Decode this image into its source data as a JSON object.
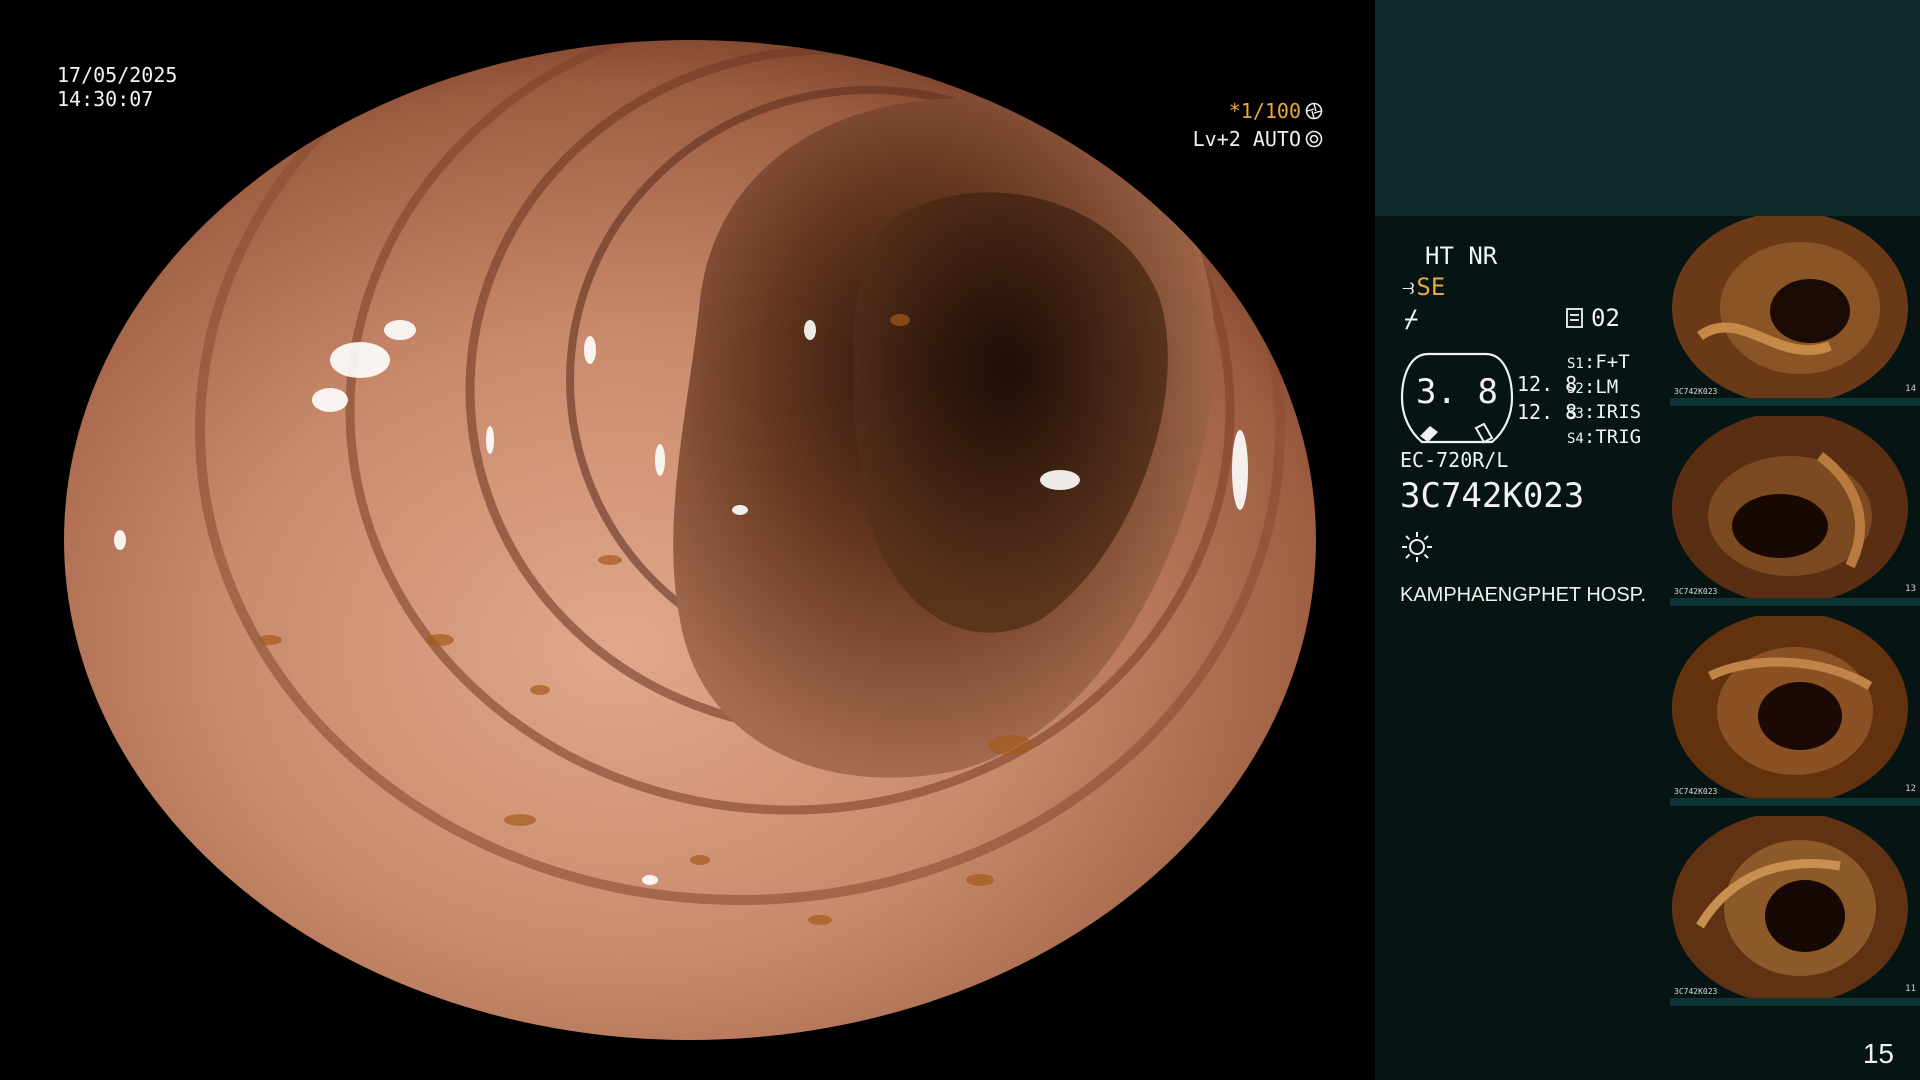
{
  "overlay": {
    "date": "17/05/2025",
    "time": "14:30:07",
    "shutter": "*1/100",
    "shutter_icon": "aperture-icon",
    "level": "Lv+2 AUTO",
    "level_icon": "iris-icon"
  },
  "panel": {
    "mode": "HT NR",
    "enhance_mode": "SE",
    "enhance_icon": "structure-enhance-icon",
    "color_icon": "color-enhance-icon",
    "memory": "02",
    "memory_icon": "memory-doc-icon",
    "gauge_value": "3. 8",
    "pressure_1": "12. 8",
    "pressure_2": "12. 8",
    "switches": [
      {
        "key": "S1",
        "value": "F+T"
      },
      {
        "key": "S2",
        "value": "LM"
      },
      {
        "key": "S3",
        "value": "IRIS"
      },
      {
        "key": "S4",
        "value": "TRIG"
      }
    ],
    "scope_model": "EC-720R/L",
    "scope_serial": "3C742K023",
    "light_icon": "light-source-icon",
    "hospital": "KAMPHAENGPHET HOSP."
  },
  "thumbnails": [
    {
      "num": "14",
      "serial": "3C742K023"
    },
    {
      "num": "13",
      "serial": "3C742K023"
    },
    {
      "num": "12",
      "serial": "3C742K023"
    },
    {
      "num": "11",
      "serial": "3C742K023"
    }
  ],
  "page_number": "15",
  "colors": {
    "accent": "#e9a93a",
    "panel_top": "#0d2a2a",
    "panel_main": "#061414"
  }
}
